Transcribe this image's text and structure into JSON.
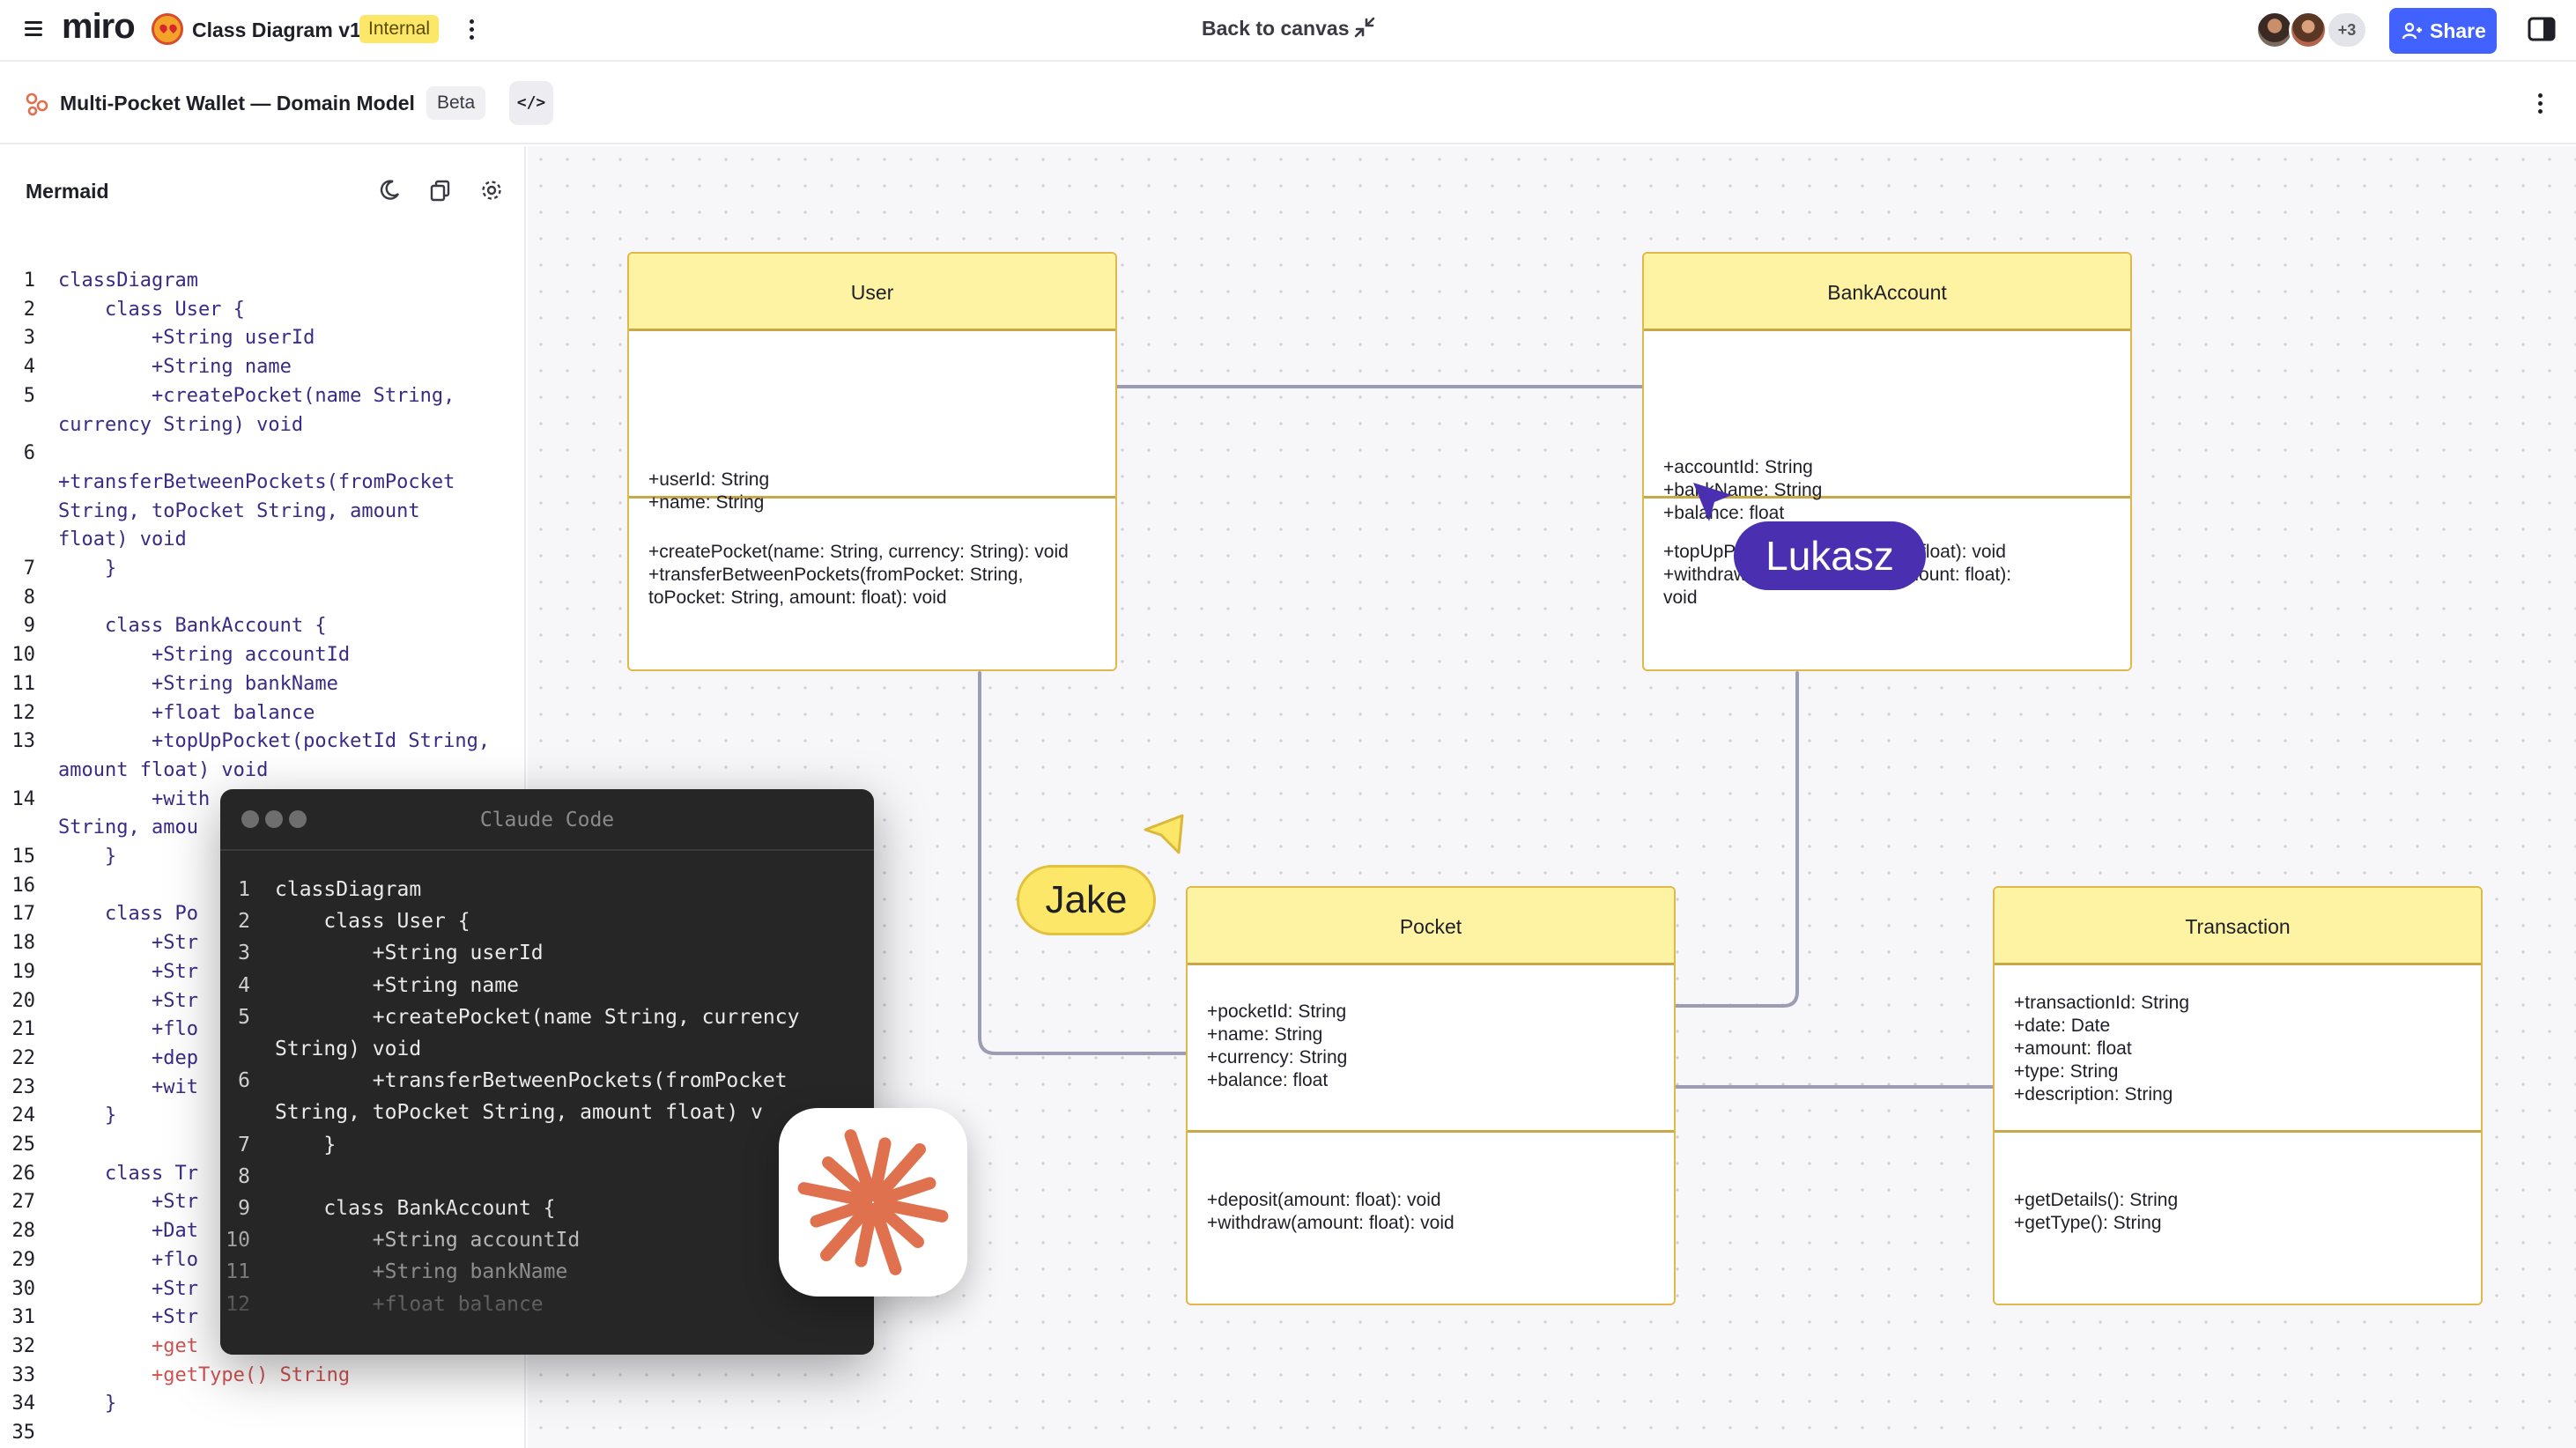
{
  "topbar": {
    "logo": "miro",
    "board_title": "Class Diagram v1",
    "badge": "Internal",
    "back_to_canvas": "Back to canvas",
    "avatars_more": "+3",
    "share_label": "Share",
    "colors": {
      "share": "#4262ff",
      "badge": "#fde768"
    }
  },
  "subbar": {
    "diagram_title": "Multi-Pocket Wallet — Domain Model",
    "badge": "Beta",
    "code_toggle": "</>"
  },
  "mermaid_panel": {
    "title": "Mermaid",
    "tools": [
      "theme-icon",
      "copy-icon",
      "settings-icon"
    ],
    "lines": [
      {
        "n": "1",
        "text": "classDiagram"
      },
      {
        "n": "2",
        "text": "    class User {"
      },
      {
        "n": "3",
        "text": "        +String userId"
      },
      {
        "n": "4",
        "text": "        +String name"
      },
      {
        "n": "5",
        "text": "        +createPocket(name String,"
      },
      {
        "n": "",
        "text": "currency String) void"
      },
      {
        "n": "6",
        "text": ""
      },
      {
        "n": "",
        "text": "+transferBetweenPockets(fromPocket"
      },
      {
        "n": "",
        "text": "String, toPocket String, amount"
      },
      {
        "n": "",
        "text": "float) void"
      },
      {
        "n": "7",
        "text": "    }"
      },
      {
        "n": "8",
        "text": ""
      },
      {
        "n": "9",
        "text": "    class BankAccount {"
      },
      {
        "n": "10",
        "text": "        +String accountId"
      },
      {
        "n": "11",
        "text": "        +String bankName"
      },
      {
        "n": "12",
        "text": "        +float balance"
      },
      {
        "n": "13",
        "text": "        +topUpPocket(pocketId String,"
      },
      {
        "n": "",
        "text": "amount float) void"
      },
      {
        "n": "14",
        "text": "        +with"
      },
      {
        "n": "",
        "text": "String, amou"
      },
      {
        "n": "15",
        "text": "    }"
      },
      {
        "n": "16",
        "text": ""
      },
      {
        "n": "17",
        "text": "    class Po"
      },
      {
        "n": "18",
        "text": "        +Str"
      },
      {
        "n": "19",
        "text": "        +Str"
      },
      {
        "n": "20",
        "text": "        +Str"
      },
      {
        "n": "21",
        "text": "        +flo"
      },
      {
        "n": "22",
        "text": "        +dep"
      },
      {
        "n": "23",
        "text": "        +wit"
      },
      {
        "n": "24",
        "text": "    }"
      },
      {
        "n": "25",
        "text": ""
      },
      {
        "n": "26",
        "text": "    class Tr"
      },
      {
        "n": "27",
        "text": "        +Str"
      },
      {
        "n": "28",
        "text": "        +Dat"
      },
      {
        "n": "29",
        "text": "        +flo"
      },
      {
        "n": "30",
        "text": "        +Str"
      },
      {
        "n": "31",
        "text": "        +Str"
      },
      {
        "n": "32",
        "text": "        +get"
      },
      {
        "n": "33",
        "text": "        +getType() String"
      },
      {
        "n": "34",
        "text": "    }"
      },
      {
        "n": "35",
        "text": ""
      }
    ]
  },
  "classes": {
    "user": {
      "name": "User",
      "attributes": "+userId: String\n+name: String",
      "methods": "+createPocket(name: String, currency: String): void\n+transferBetweenPockets(fromPocket: String,\ntoPocket: String, amount: float): void"
    },
    "bank_account": {
      "name": "BankAccount",
      "attributes": "+accountId: String\n+bankName: String\n+balance: float",
      "methods": "+topUpP                    , amount: float): void\n+withdraw                 String, amount: float):\nvoid"
    },
    "pocket": {
      "name": "Pocket",
      "attributes": "+pocketId: String\n+name: String\n+currency: String\n+balance: float",
      "methods": "+deposit(amount: float): void\n+withdraw(amount: float): void"
    },
    "transaction": {
      "name": "Transaction",
      "attributes": "+transactionId: String\n+date: Date\n+amount: float\n+type: String\n+description: String",
      "methods": "+getDetails(): String\n+getType(): String"
    }
  },
  "cursors": {
    "lukasz": {
      "name": "Lukasz",
      "color": "#4a2fb0"
    },
    "jake": {
      "name": "Jake",
      "color": "#fde768"
    }
  },
  "claude_code": {
    "title": "Claude Code",
    "lines": [
      {
        "n": "1",
        "text": "classDiagram"
      },
      {
        "n": "2",
        "text": "    class User {"
      },
      {
        "n": "3",
        "text": "        +String userId"
      },
      {
        "n": "4",
        "text": "        +String name"
      },
      {
        "n": "5",
        "text": "        +createPocket(name String, currency"
      },
      {
        "n": "",
        "text": "String) void"
      },
      {
        "n": "6",
        "text": "        +transferBetweenPockets(fromPocket"
      },
      {
        "n": "",
        "text": "String, toPocket String, amount float) v"
      },
      {
        "n": "7",
        "text": "    }"
      },
      {
        "n": "8",
        "text": ""
      },
      {
        "n": "9",
        "text": "    class BankAccount {"
      },
      {
        "n": "10",
        "text": "        +String accountId"
      },
      {
        "n": "11",
        "text": "        +String bankName"
      },
      {
        "n": "12",
        "text": "        +float balance"
      }
    ],
    "logo_color": "#e0714f"
  }
}
